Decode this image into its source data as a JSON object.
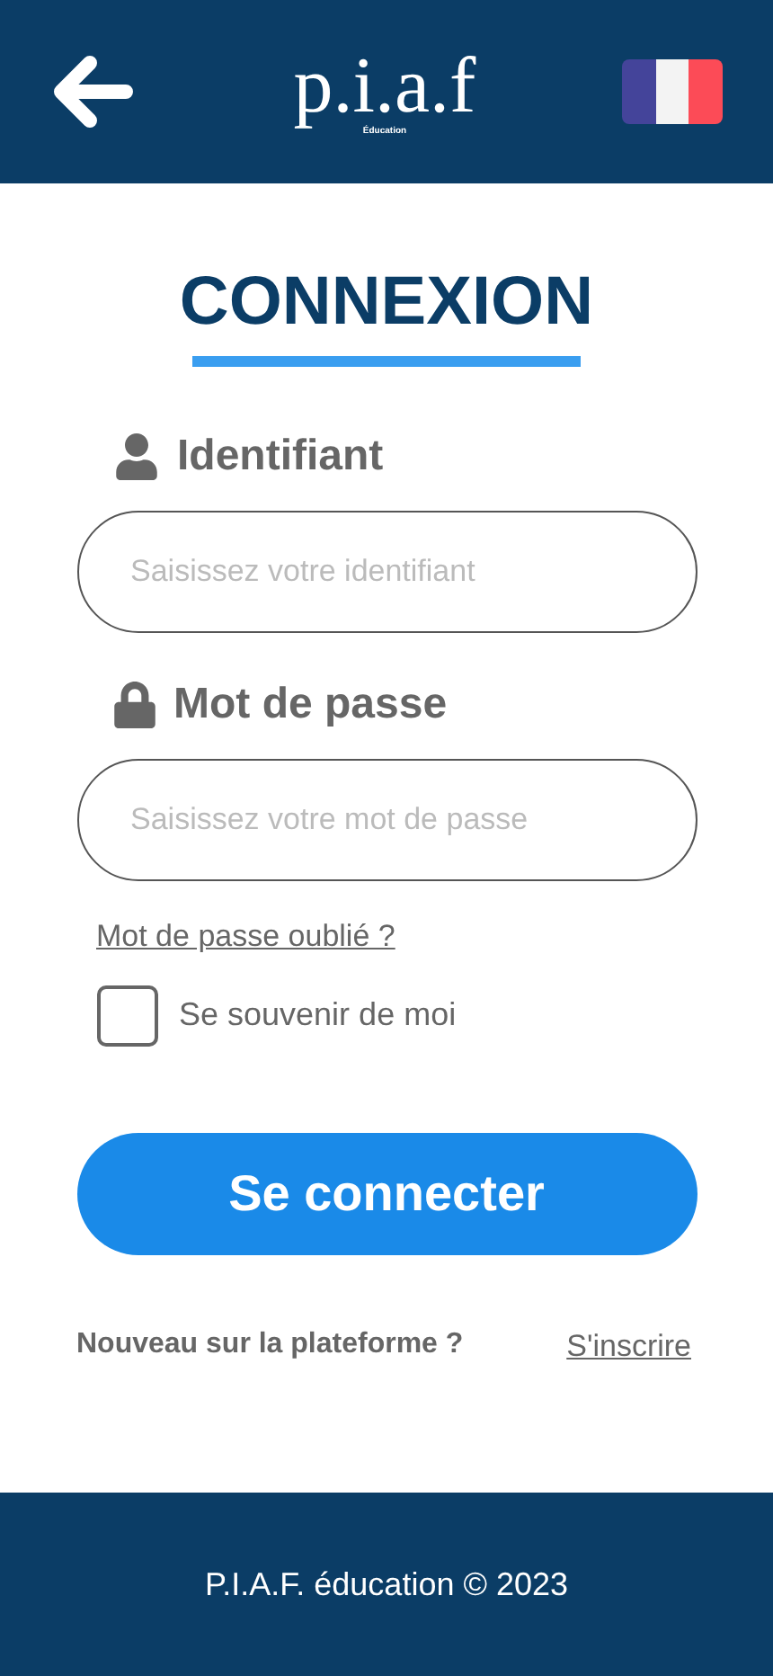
{
  "header": {
    "logo": "p.i.a.f",
    "logo_subtitle": "Éducation"
  },
  "title": "CONNEXION",
  "fields": [
    {
      "kind": "user",
      "label": "Identifiant",
      "placeholder": "Saisissez votre identifiant"
    },
    {
      "kind": "lock",
      "label": "Mot de passe",
      "placeholder": "Saisissez votre mot de passe"
    }
  ],
  "forgot_link": "Mot de passe oublié ?",
  "remember": {
    "label": "Se souvenir de moi",
    "checked": false
  },
  "submit": "Se connecter",
  "signup": {
    "text": "Nouveau sur la plateforme ?",
    "link": "S'inscrire"
  },
  "footer": "P.I.A.F. éducation © 2023"
}
